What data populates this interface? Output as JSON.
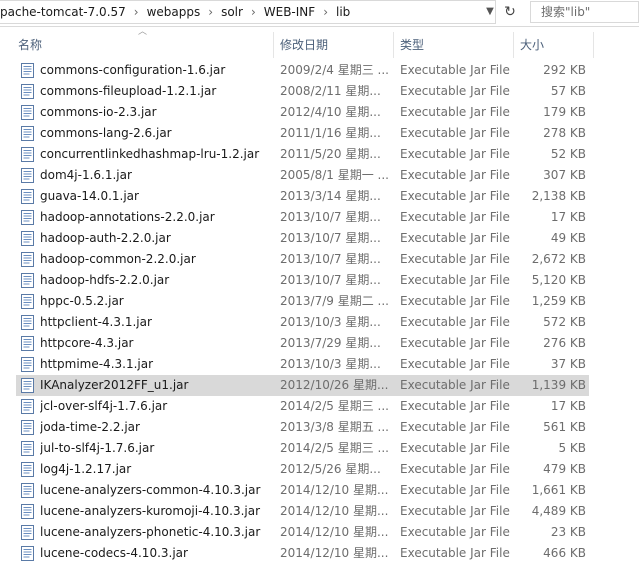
{
  "address": {
    "crumbs": [
      "pache-tomcat-7.0.57",
      "webapps",
      "solr",
      "WEB-INF",
      "lib"
    ],
    "search_placeholder": "搜索\"lib\""
  },
  "columns": {
    "name": "名称",
    "date": "修改日期",
    "type": "类型",
    "size": "大小"
  },
  "files": [
    {
      "name": "commons-configuration-1.6.jar",
      "date": "2009/2/4 星期三 ...",
      "type": "Executable Jar File",
      "size": "292 KB"
    },
    {
      "name": "commons-fileupload-1.2.1.jar",
      "date": "2008/2/11 星期...",
      "type": "Executable Jar File",
      "size": "57 KB"
    },
    {
      "name": "commons-io-2.3.jar",
      "date": "2012/4/10 星期...",
      "type": "Executable Jar File",
      "size": "179 KB"
    },
    {
      "name": "commons-lang-2.6.jar",
      "date": "2011/1/16 星期...",
      "type": "Executable Jar File",
      "size": "278 KB"
    },
    {
      "name": "concurrentlinkedhashmap-lru-1.2.jar",
      "date": "2011/5/20 星期...",
      "type": "Executable Jar File",
      "size": "52 KB"
    },
    {
      "name": "dom4j-1.6.1.jar",
      "date": "2005/8/1 星期一 ...",
      "type": "Executable Jar File",
      "size": "307 KB"
    },
    {
      "name": "guava-14.0.1.jar",
      "date": "2013/3/14 星期...",
      "type": "Executable Jar File",
      "size": "2,138 KB"
    },
    {
      "name": "hadoop-annotations-2.2.0.jar",
      "date": "2013/10/7 星期...",
      "type": "Executable Jar File",
      "size": "17 KB"
    },
    {
      "name": "hadoop-auth-2.2.0.jar",
      "date": "2013/10/7 星期...",
      "type": "Executable Jar File",
      "size": "49 KB"
    },
    {
      "name": "hadoop-common-2.2.0.jar",
      "date": "2013/10/7 星期...",
      "type": "Executable Jar File",
      "size": "2,672 KB"
    },
    {
      "name": "hadoop-hdfs-2.2.0.jar",
      "date": "2013/10/7 星期...",
      "type": "Executable Jar File",
      "size": "5,120 KB"
    },
    {
      "name": "hppc-0.5.2.jar",
      "date": "2013/7/9 星期二 ...",
      "type": "Executable Jar File",
      "size": "1,259 KB"
    },
    {
      "name": "httpclient-4.3.1.jar",
      "date": "2013/10/3 星期...",
      "type": "Executable Jar File",
      "size": "572 KB"
    },
    {
      "name": "httpcore-4.3.jar",
      "date": "2013/7/29 星期...",
      "type": "Executable Jar File",
      "size": "276 KB"
    },
    {
      "name": "httpmime-4.3.1.jar",
      "date": "2013/10/3 星期...",
      "type": "Executable Jar File",
      "size": "37 KB"
    },
    {
      "name": "IKAnalyzer2012FF_u1.jar",
      "date": "2012/10/26 星期...",
      "type": "Executable Jar File",
      "size": "1,139 KB",
      "selected": true
    },
    {
      "name": "jcl-over-slf4j-1.7.6.jar",
      "date": "2014/2/5 星期三 ...",
      "type": "Executable Jar File",
      "size": "17 KB"
    },
    {
      "name": "joda-time-2.2.jar",
      "date": "2013/3/8 星期五 ...",
      "type": "Executable Jar File",
      "size": "561 KB"
    },
    {
      "name": "jul-to-slf4j-1.7.6.jar",
      "date": "2014/2/5 星期三 ...",
      "type": "Executable Jar File",
      "size": "5 KB"
    },
    {
      "name": "log4j-1.2.17.jar",
      "date": "2012/5/26 星期...",
      "type": "Executable Jar File",
      "size": "479 KB"
    },
    {
      "name": "lucene-analyzers-common-4.10.3.jar",
      "date": "2014/12/10 星期...",
      "type": "Executable Jar File",
      "size": "1,661 KB"
    },
    {
      "name": "lucene-analyzers-kuromoji-4.10.3.jar",
      "date": "2014/12/10 星期...",
      "type": "Executable Jar File",
      "size": "4,489 KB"
    },
    {
      "name": "lucene-analyzers-phonetic-4.10.3.jar",
      "date": "2014/12/10 星期...",
      "type": "Executable Jar File",
      "size": "23 KB"
    },
    {
      "name": "lucene-codecs-4.10.3.jar",
      "date": "2014/12/10 星期...",
      "type": "Executable Jar File",
      "size": "466 KB"
    }
  ]
}
